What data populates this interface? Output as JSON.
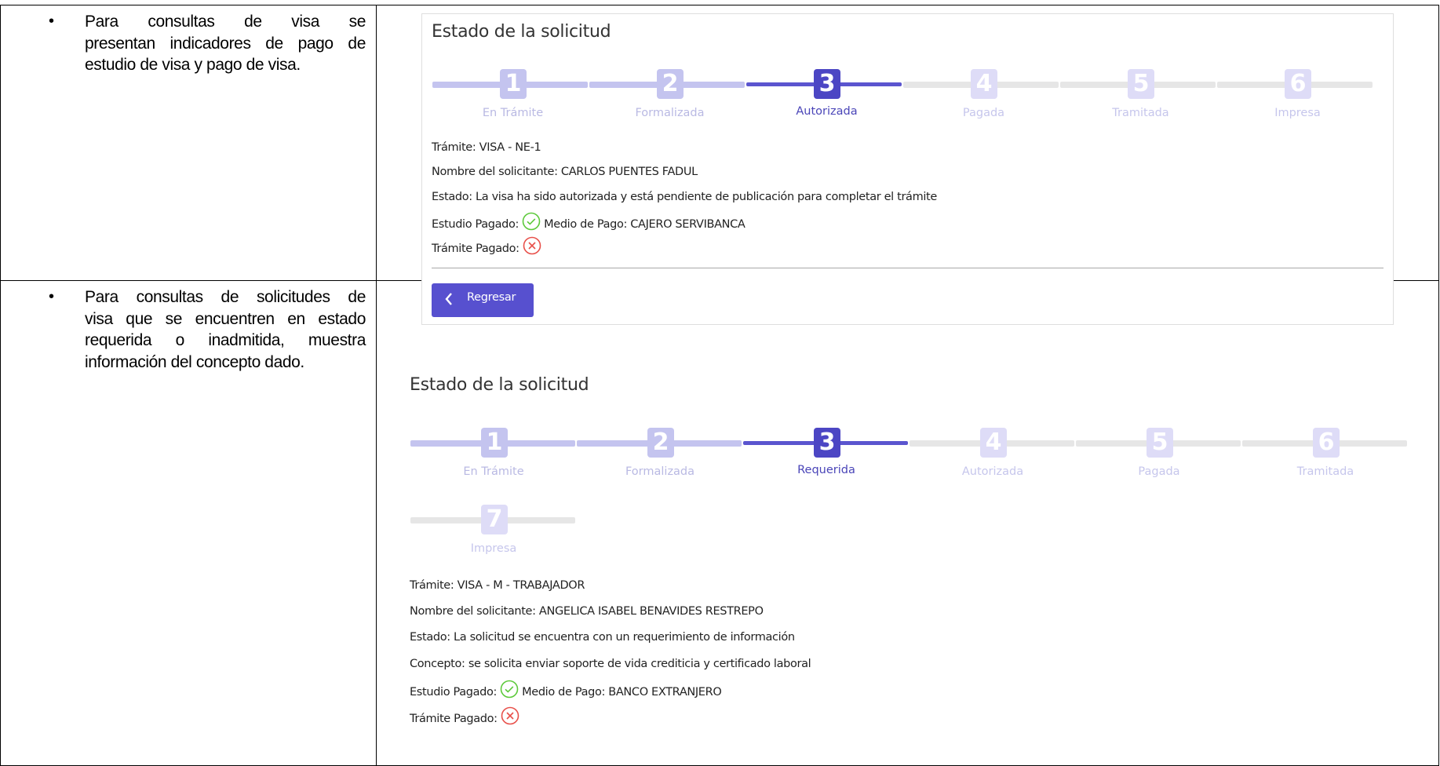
{
  "row1": {
    "bullet_lines": [
      "Para consultas de visa se",
      "presentan indicadores de pago de",
      "estudio de visa y pago de visa."
    ],
    "panel": {
      "title": "Estado de la solicitud",
      "steps": [
        {
          "num": "1",
          "label": "En Trámite",
          "state": "done"
        },
        {
          "num": "2",
          "label": "Formalizada",
          "state": "done"
        },
        {
          "num": "3",
          "label": "Autorizada",
          "state": "current"
        },
        {
          "num": "4",
          "label": "Pagada",
          "state": "pending"
        },
        {
          "num": "5",
          "label": "Tramitada",
          "state": "pending"
        },
        {
          "num": "6",
          "label": "Impresa",
          "state": "pending"
        }
      ],
      "tramite": "Trámite: VISA - NE-1",
      "solicitante": "Nombre del solicitante: CARLOS PUENTES FADUL",
      "estado": "Estado: La visa ha sido autorizada y está pendiente de publicación para completar el trámite",
      "estudio_label": "Estudio Pagado:",
      "estudio_status_icon": "check-circle-icon",
      "medio_pago": "Medio de Pago: CAJERO SERVIBANCA",
      "tramite_pagado_label": "Trámite Pagado:",
      "tramite_pagado_icon": "x-circle-icon",
      "back_label": "Regresar"
    }
  },
  "row2": {
    "bullet_lines": [
      "Para consultas de solicitudes de",
      "visa que se encuentren en estado",
      "requerida o inadmitida, muestra",
      "información del concepto dado."
    ],
    "panel": {
      "title": "Estado de la solicitud",
      "steps": [
        {
          "num": "1",
          "label": "En Trámite",
          "state": "done"
        },
        {
          "num": "2",
          "label": "Formalizada",
          "state": "done"
        },
        {
          "num": "3",
          "label": "Requerida",
          "state": "current"
        },
        {
          "num": "4",
          "label": "Autorizada",
          "state": "pending"
        },
        {
          "num": "5",
          "label": "Pagada",
          "state": "pending"
        },
        {
          "num": "6",
          "label": "Tramitada",
          "state": "pending"
        },
        {
          "num": "7",
          "label": "Impresa",
          "state": "pending"
        }
      ],
      "tramite": "Trámite: VISA - M - TRABAJADOR",
      "solicitante": "Nombre del solicitante: ANGELICA ISABEL BENAVIDES RESTREPO",
      "estado": "Estado: La solicitud se encuentra con un requerimiento de información",
      "concepto": "Concepto: se solicita enviar soporte de vida crediticia y certificado laboral",
      "estudio_label": "Estudio Pagado:",
      "estudio_status_icon": "check-circle-icon",
      "medio_pago": "Medio de Pago: BANCO EXTRANJERO",
      "tramite_pagado_label": "Trámite Pagado:",
      "tramite_pagado_icon": "x-circle-icon"
    }
  },
  "colors": {
    "accent": "#5750cf",
    "current_step": "#4c46c4",
    "done_step": "#c4c4ef",
    "pending_step": "#dedcf7",
    "ok": "#5cc93a",
    "error": "#e8504a"
  }
}
